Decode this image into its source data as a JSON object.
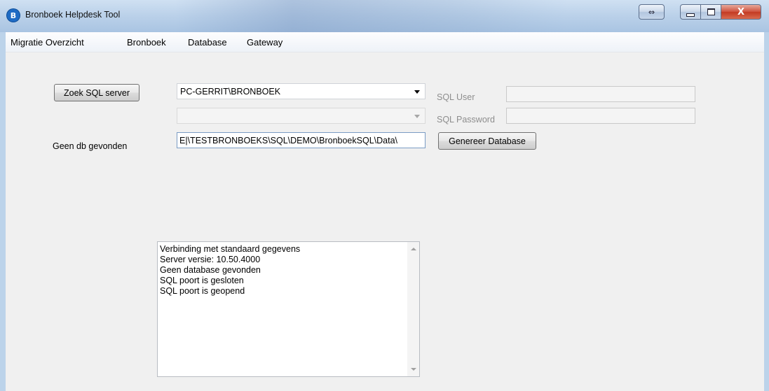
{
  "window": {
    "icon_letter": "B",
    "title": "Bronboek Helpdesk Tool",
    "close_glyph": "X"
  },
  "menu": {
    "items": [
      "Migratie Overzicht",
      "Bronboek",
      "Database",
      "Gateway"
    ]
  },
  "form": {
    "find_server_button": "Zoek SQL server",
    "server_value": "PC-GERRIT\\BRONBOEK",
    "database_value": "",
    "status_label": "Geen db gevonden",
    "path_value": "E|\\TESTBRONBOEKS\\SQL\\DEMO\\BronboekSQL\\Data\\",
    "sql_user_label": "SQL User",
    "sql_user_value": "",
    "sql_password_label": "SQL Password",
    "sql_password_value": "",
    "generate_button": "Genereer Database"
  },
  "log": {
    "lines": [
      "Verbinding met standaard gegevens",
      "Server versie: 10.50.4000",
      "Geen database gevonden",
      "SQL poort is gesloten",
      "SQL poort is geopend"
    ]
  }
}
